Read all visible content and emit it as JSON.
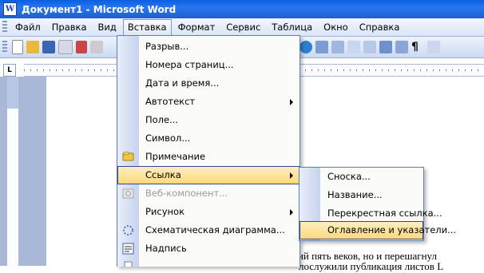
{
  "window": {
    "title": "Документ1 - Microsoft Word"
  },
  "menubar": {
    "items": [
      "Файл",
      "Правка",
      "Вид",
      "Вставка",
      "Формат",
      "Сервис",
      "Таблица",
      "Окно",
      "Справка"
    ],
    "active_index": 3
  },
  "ruler": {
    "corner": "L"
  },
  "insert_menu": {
    "items": [
      {
        "label": "Разрыв...",
        "submenu": false,
        "icon": null
      },
      {
        "label": "Номера страниц...",
        "submenu": false,
        "icon": null
      },
      {
        "label": "Дата и время...",
        "submenu": false,
        "icon": null
      },
      {
        "label": "Автотекст",
        "submenu": true,
        "icon": null
      },
      {
        "label": "Поле...",
        "submenu": false,
        "icon": null
      },
      {
        "label": "Символ...",
        "submenu": false,
        "icon": null
      },
      {
        "label": "Примечание",
        "submenu": false,
        "icon": "comment-icon"
      },
      {
        "label": "Ссылка",
        "submenu": true,
        "icon": null,
        "highlighted": true
      },
      {
        "label": "Веб-компонент...",
        "submenu": false,
        "icon": "web-component-icon",
        "disabled": true
      },
      {
        "label": "Рисунок",
        "submenu": true,
        "icon": null
      },
      {
        "label": "Схематическая диаграмма...",
        "submenu": false,
        "icon": "diagram-icon"
      },
      {
        "label": "Надпись",
        "submenu": false,
        "icon": "textbox-icon"
      }
    ]
  },
  "reference_submenu": {
    "items": [
      {
        "label": "Сноска..."
      },
      {
        "label": "Название..."
      },
      {
        "label": "Перекрестная ссылка..."
      },
      {
        "label": "Оглавление и указатели...",
        "highlighted": true
      }
    ]
  },
  "document": {
    "visible_lines": [
      "ний пять веков, но и перешагнул",
      "лослужили публикация листов L"
    ]
  },
  "colors": {
    "title_bar": "#1b5fd6",
    "menu_highlight": "#fbd879",
    "menu_gutter": "#c6d3ee",
    "workspace": "#a9b8d6"
  }
}
